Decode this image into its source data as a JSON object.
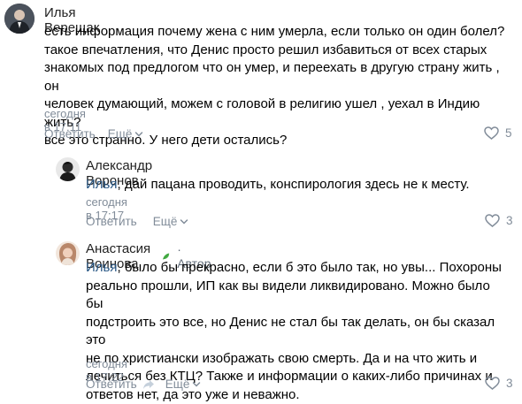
{
  "comments": [
    {
      "author": "Илья Верещак",
      "lines": [
        "есть информация почему жена с ним умерла, если только он один болел?",
        "такое впечатления, что Денис просто решил избавиться от всех старых",
        "знакомых под предлогом что он умер, и переехать в другую страну жить , он",
        "человек думающий, можем с головой в религию ушел , уехал в Индию жить?",
        "все это странно. У него дети остались?"
      ],
      "time": "сегодня в 17:11",
      "reply_label": "Ответить",
      "more_label": "Ещё",
      "likes": "5"
    },
    {
      "author": "Александр Воронов",
      "mention": "Илья",
      "lines": [
        ", дай пацана проводить, конспирология здесь не к месту."
      ],
      "time": "сегодня в 17:17",
      "reply_label": "Ответить",
      "more_label": "Ещё",
      "likes": "3"
    },
    {
      "author": "Анастасия Воинова",
      "author_badge": "· Автор",
      "mention": "Илья",
      "lines": [
        ", было бы прекрасно, если б это было так, но увы... Похороны",
        "реально прошли, ИП как вы видели ликвидировано. Можно было бы",
        "подстроить это все, но Денис не стал бы так делать, он бы сказал это",
        "не по христиански изображать свою смерть. Да и на что жить и",
        "лечиться без КТЦ? Также и информации о каких-либо причинах и",
        "ответов нет, да это уже и неважно."
      ],
      "time": "сегодня в 17:22",
      "reply_label": "Ответить",
      "more_label": "Ещё",
      "likes": "3"
    }
  ],
  "colors": {
    "link": "#2a5885",
    "secondary": "#818c99",
    "leaf": "#4bb34b"
  },
  "icons": {
    "like": "heart-outline-icon",
    "more": "chevron-down-icon",
    "reply_action": "share-arrow-icon",
    "author_badge": "leaf-icon"
  }
}
